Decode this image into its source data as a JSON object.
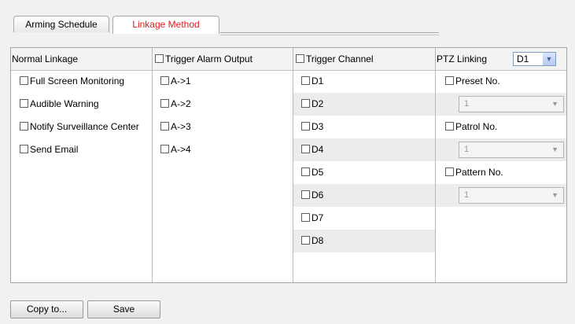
{
  "tabs": [
    "Arming Schedule",
    "Linkage Method"
  ],
  "headers": {
    "normal": "Normal Linkage",
    "alarm_output": "Trigger Alarm Output",
    "channel": "Trigger Channel",
    "ptz": "PTZ Linking"
  },
  "ptz_select_value": "D1",
  "normal_linkage": [
    "Full Screen Monitoring",
    "Audible Warning",
    "Notify Surveillance Center",
    "Send Email"
  ],
  "alarm_outputs": [
    "A->1",
    "A->2",
    "A->3",
    "A->4"
  ],
  "channels": [
    "D1",
    "D2",
    "D3",
    "D4",
    "D5",
    "D6",
    "D7",
    "D8"
  ],
  "ptz": {
    "preset_label": "Preset No.",
    "preset_value": "1",
    "patrol_label": "Patrol No.",
    "patrol_value": "1",
    "pattern_label": "Pattern No.",
    "pattern_value": "1"
  },
  "buttons": {
    "copy": "Copy to...",
    "save": "Save"
  },
  "colors": {
    "active_tab": "#e0191e",
    "row_alt": "#ececec"
  }
}
